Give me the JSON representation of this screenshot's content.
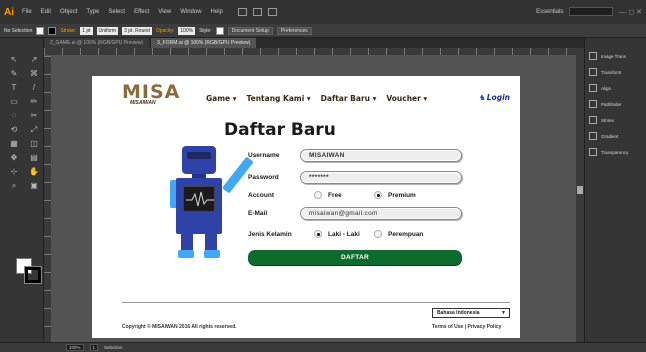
{
  "app": {
    "logo": "Ai",
    "menu": [
      "File",
      "Edit",
      "Object",
      "Type",
      "Select",
      "Effect",
      "View",
      "Window",
      "Help"
    ],
    "workspace": "Essentials",
    "window_controls": "—  ◻  ✕"
  },
  "control_bar": {
    "selection": "No Selection",
    "stroke_label": "Stroke:",
    "stroke_weight": "1 pt",
    "profile": "Uniform",
    "brush": "3 pt. Round",
    "opacity_label": "Opacity:",
    "opacity_value": "100%",
    "style_label": "Style:",
    "document_setup": "Document Setup",
    "preferences": "Preferences"
  },
  "tabs": [
    {
      "label": "2_GAME.ai @ 100% (RGB/GPU Preview)",
      "active": false
    },
    {
      "label": "3_FORM.ai @ 100% (RGB/GPU Preview)",
      "active": true
    }
  ],
  "tools": [
    "↖",
    "↗",
    "✎",
    "⌘",
    "T",
    "/",
    "▭",
    "✏",
    "◌",
    "✂",
    "⟲",
    "⤢",
    "▦",
    "◫",
    "✥",
    "▤",
    "⊹",
    "✋",
    "⌕",
    "▣"
  ],
  "panels": [
    "Image Trace",
    "Transform",
    "Align",
    "Pathfinder",
    "Stroke",
    "Gradient",
    "Transparency"
  ],
  "status": {
    "zoom": "100%",
    "page": "1",
    "tool": "Selection"
  },
  "site": {
    "logo_main": "MISA",
    "logo_sub": "MISAIWAN",
    "nav": [
      "Game ▾",
      "Tentang Kami ▾",
      "Daftar Baru ▾",
      "Voucher ▾"
    ],
    "login_icon": "user-icon",
    "login": "Login",
    "title": "Daftar Baru",
    "form": {
      "username_label": "Username",
      "username_value": "MISAIWAN",
      "password_label": "Password",
      "password_value": "*******",
      "account_label": "Account",
      "account_options": [
        "Free",
        "Premium"
      ],
      "account_selected": "Premium",
      "email_label": "E-Mail",
      "email_value": "misaiwan@gmail.com",
      "gender_label": "Jenis Kelamin",
      "gender_options": [
        "Laki - Laki",
        "Perempuan"
      ],
      "gender_selected": "Laki - Laki",
      "submit": "DAFTAR"
    },
    "footer": {
      "copyright": "Copyright © MISAIWAN 2016 All rights reserved.",
      "language": "Bahasa Indonesia",
      "links": "Terms of Use | Privacy Policy"
    },
    "colors": {
      "brand": "#8a6b3e",
      "submit": "#0e6b2e",
      "login": "#1a2f8a",
      "robot": "#2e42a8",
      "robot_accent": "#3fa9f5"
    }
  }
}
